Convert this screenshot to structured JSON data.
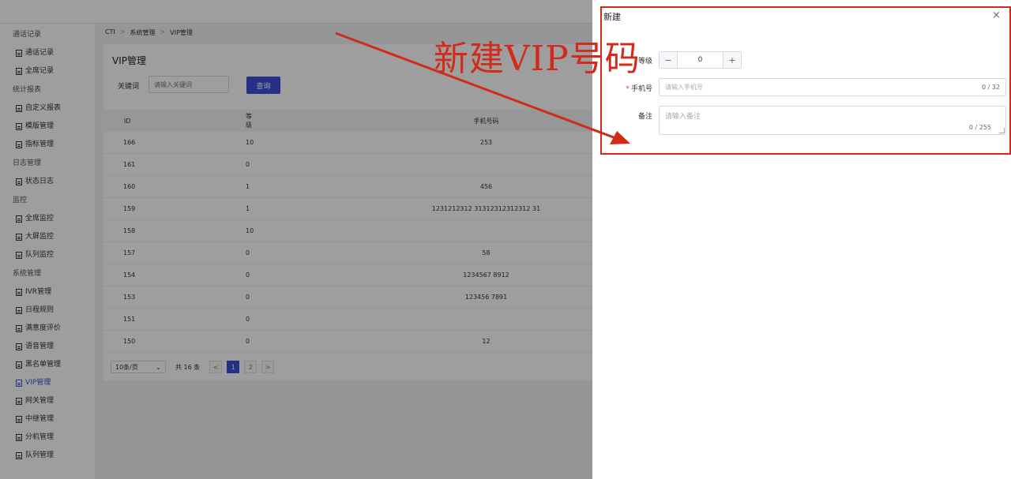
{
  "sidebar": {
    "sections": [
      {
        "title": "通话记录",
        "items": [
          "通话记录",
          "全席记录"
        ]
      },
      {
        "title": "统计报表",
        "items": [
          "自定义报表",
          "模版管理",
          "指标管理"
        ]
      },
      {
        "title": "日志管理",
        "items": [
          "状态日志"
        ]
      },
      {
        "title": "监控",
        "items": [
          "全席监控",
          "大屏监控",
          "队列监控"
        ]
      },
      {
        "title": "系统管理",
        "items": [
          "IVR管理",
          "日程规则",
          "满意度评价",
          "语音管理",
          "黑名单管理",
          "VIP管理",
          "网关管理",
          "中继管理",
          "分机管理",
          "队列管理"
        ]
      }
    ],
    "active_item": "VIP管理"
  },
  "breadcrumb": [
    "CTI",
    "系统管理",
    "VIP管理"
  ],
  "page": {
    "title": "VIP管理",
    "keyword_label": "关键词",
    "keyword_placeholder": "请输入关键词",
    "query_label": "查询"
  },
  "table": {
    "columns": [
      "ID",
      "等级",
      "手机号码"
    ],
    "rows": [
      {
        "id": "166",
        "level": "10",
        "phone": "253"
      },
      {
        "id": "161",
        "level": "0",
        "phone": ""
      },
      {
        "id": "160",
        "level": "1",
        "phone": "456"
      },
      {
        "id": "159",
        "level": "1",
        "phone": "1231212312 31312312312312 31"
      },
      {
        "id": "158",
        "level": "10",
        "phone": ""
      },
      {
        "id": "157",
        "level": "0",
        "phone": "58"
      },
      {
        "id": "154",
        "level": "0",
        "phone": "1234567 8912"
      },
      {
        "id": "153",
        "level": "0",
        "phone": "123456 7891"
      },
      {
        "id": "151",
        "level": "0",
        "phone": ""
      },
      {
        "id": "150",
        "level": "0",
        "phone": "12"
      }
    ]
  },
  "pagination": {
    "page_size": "10条/页",
    "total": "共 16 条",
    "prev": "<",
    "pages": [
      "1",
      "2"
    ],
    "next": ">",
    "current": "1"
  },
  "dialog": {
    "title": "新建",
    "close": "×",
    "level_label": "等级",
    "level_value": "0",
    "minus": "−",
    "plus": "+",
    "phone_label": "手机号",
    "phone_placeholder": "请输入手机号",
    "phone_counter": "0 / 32",
    "remark_label": "备注",
    "remark_placeholder": "请输入备注",
    "remark_counter": "0 / 255"
  },
  "annotation": {
    "text": "新建VIP号码",
    "color": "#d22b1a"
  },
  "colors": {
    "primary": "#3a4fd6",
    "required": "#e03a3a"
  }
}
